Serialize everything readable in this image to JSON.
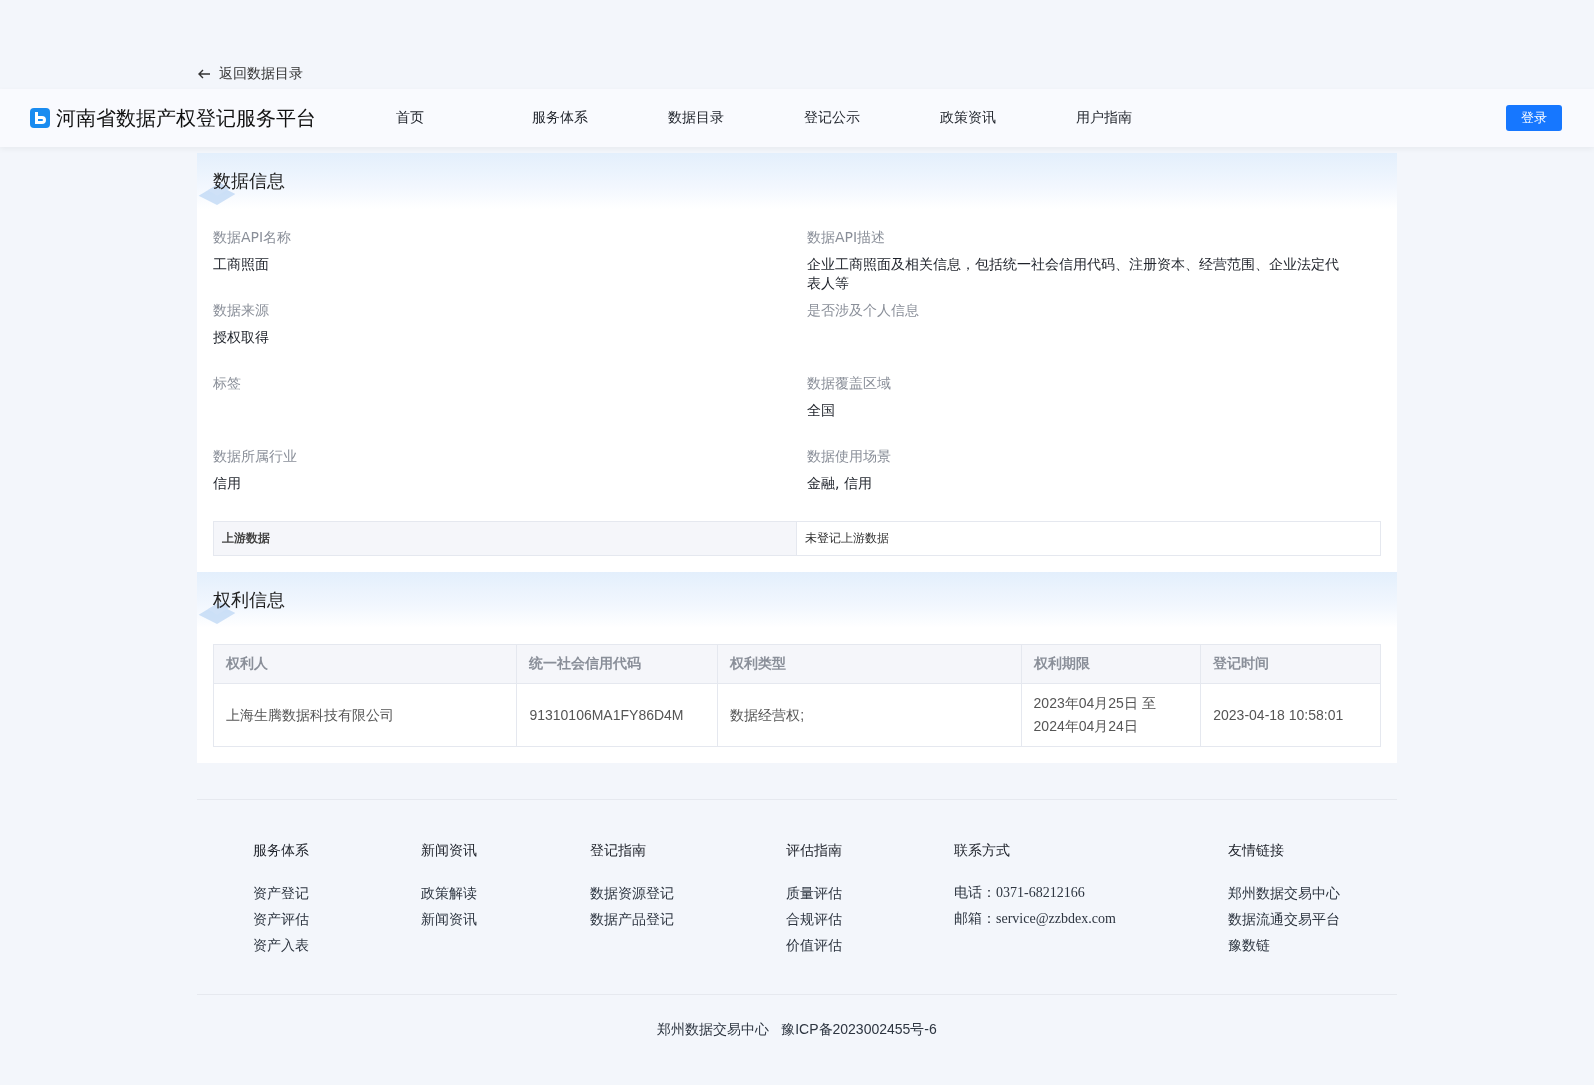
{
  "back_link": "返回数据目录",
  "header": {
    "title": "河南省数据产权登记服务平台",
    "nav": [
      {
        "label": "首页",
        "selected": false
      },
      {
        "label": "服务体系",
        "selected": false
      },
      {
        "label": "数据目录",
        "selected": false
      },
      {
        "label": "登记公示",
        "selected": false
      },
      {
        "label": "政策资讯",
        "selected": false
      },
      {
        "label": "用户指南",
        "selected": false
      }
    ],
    "login": "登录"
  },
  "data_info": {
    "heading": "数据信息",
    "fields": [
      {
        "label": "数据API名称",
        "value": "工商照面"
      },
      {
        "label": "数据API描述",
        "value": "企业工商照面及相关信息，包括统一社会信用代码、注册资本、经营范围、企业法定代表人等"
      },
      {
        "label": "数据来源",
        "value": "授权取得"
      },
      {
        "label": "是否涉及个人信息"
      },
      {
        "label": "标签"
      },
      {
        "label": "数据覆盖区域",
        "value": "全国"
      },
      {
        "label": "数据所属行业",
        "value": "信用"
      },
      {
        "label": "数据使用场景",
        "value": "金融, 信用"
      }
    ],
    "upstream": {
      "label": "上游数据",
      "value": "未登记上游数据"
    }
  },
  "rights_info": {
    "heading": "权利信息",
    "columns": [
      "权利人",
      "统一社会信用代码",
      "权利类型",
      "权利期限",
      "登记时间"
    ],
    "rows": [
      [
        "上海生腾数据科技有限公司",
        "91310106MA1FY86D4M",
        "数据经营权;",
        "2023年04月25日 至 2024年04月24日",
        "2023-04-18 10:58:01"
      ]
    ]
  },
  "footer": {
    "columns": [
      {
        "title": "服务体系",
        "links": [
          "资产登记",
          "资产评估",
          "资产入表"
        ]
      },
      {
        "title": "新闻资讯",
        "links": [
          "政策解读",
          "新闻资讯"
        ]
      },
      {
        "title": "登记指南",
        "links": [
          "数据资源登记",
          "数据产品登记"
        ]
      },
      {
        "title": "评估指南",
        "links": [
          "质量评估",
          "合规评估",
          "价值评估"
        ]
      },
      {
        "title": "联系方式",
        "kind": "contact",
        "links": [
          "电话：0371-68212166",
          "邮箱：service@zzbdex.com"
        ]
      },
      {
        "title": "友情链接",
        "links": [
          "郑州数据交易中心",
          "数据流通交易平台",
          "豫数链"
        ]
      }
    ],
    "copyright": [
      "郑州数据交易中心",
      "豫ICP备2023002455号-6"
    ]
  }
}
